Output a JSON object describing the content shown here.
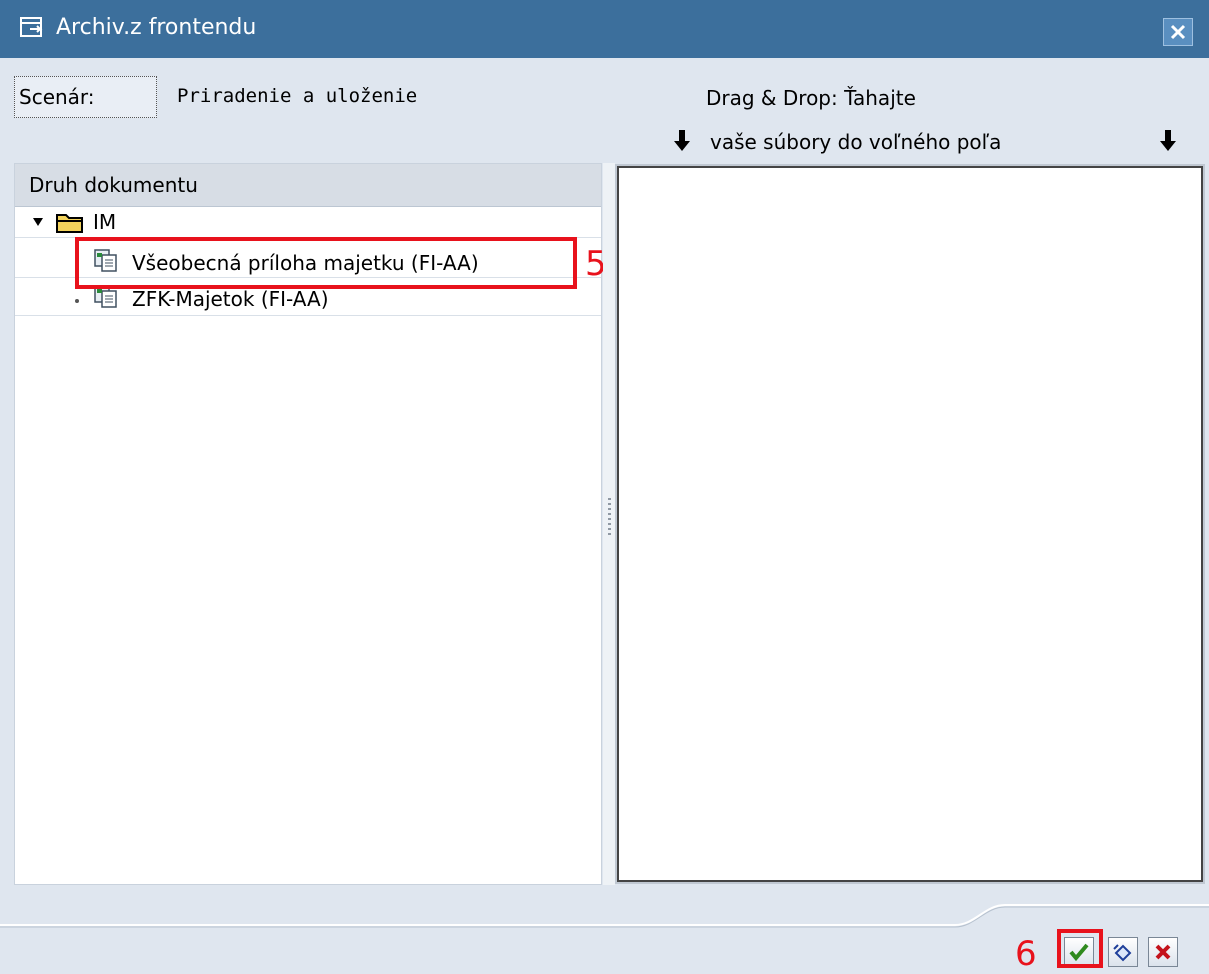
{
  "window": {
    "title": "Archiv.z frontendu",
    "close_icon": "close-icon"
  },
  "scenario": {
    "label": "Scenár:",
    "value": "Priradenie a uloženie"
  },
  "drag_drop": {
    "line1": "Drag & Drop: Ťahajte",
    "line2": "vaše súbory do voľného poľa",
    "arrow_icon": "down-arrow-icon"
  },
  "tree": {
    "header": "Druh dokumentu",
    "root": {
      "label": "IM",
      "icon": "folder-open-icon",
      "expanded": true
    },
    "items": [
      {
        "label": "Všeobecná príloha majetku  (FI-AA)",
        "icon": "document-type-icon"
      },
      {
        "label": "ZFK-Majetok (FI-AA)",
        "icon": "document-type-icon"
      }
    ]
  },
  "annotations": {
    "step5": "5",
    "step6": "6",
    "highlight_color": "#e8121c"
  },
  "buttons": {
    "ok_icon": "checkmark-icon",
    "second_icon": "undo-icon",
    "cancel_icon": "cancel-x-icon"
  },
  "colors": {
    "titlebar": "#3c6f9c",
    "background": "#dfe6ef"
  }
}
